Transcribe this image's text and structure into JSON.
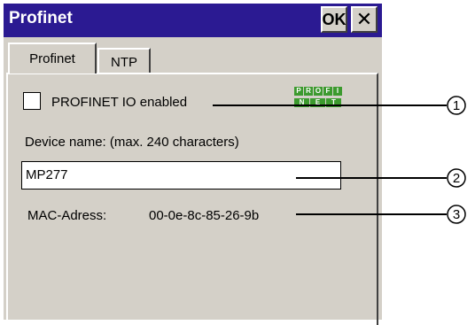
{
  "window": {
    "title": "Profinet",
    "ok_label": "OK",
    "close_glyph": "✕"
  },
  "tabs": [
    {
      "label": "Profinet",
      "active": true
    },
    {
      "label": "NTP",
      "active": false
    }
  ],
  "profinet": {
    "io_enabled_label": "PROFINET IO enabled",
    "io_enabled_checked": false,
    "device_name_label": "Device name: (max. 240 characters)",
    "device_name_value": "MP277",
    "mac_label": "MAC-Adress:",
    "mac_value": "00-0e-8c-85-26-9b"
  },
  "logo": {
    "top": [
      "P",
      "R",
      "O",
      "F",
      "I"
    ],
    "bottom": [
      "N",
      "E",
      "T"
    ]
  },
  "callouts": [
    "1",
    "2",
    "3"
  ],
  "colors": {
    "titlebar": "#2b1a92",
    "dialog_bg": "#d4d0c8",
    "logo_green": "#3c9a2e"
  }
}
